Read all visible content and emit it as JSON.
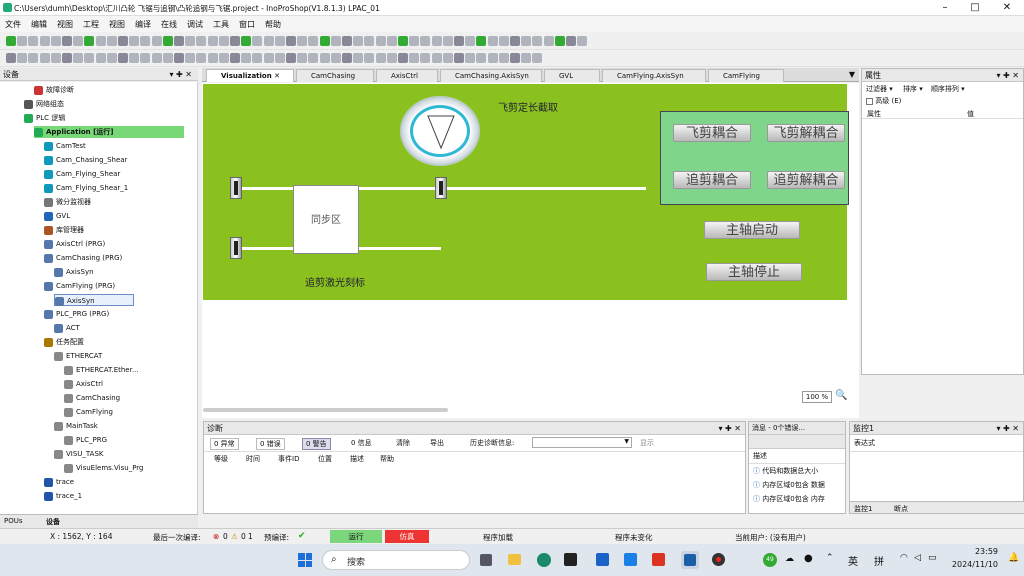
{
  "window": {
    "title": "C:\\Users\\dumh\\Desktop\\汇川凸轮 飞锯与追钢\\凸轮追钢与飞锯.project - InoProShop(V1.8.1.3) LPAC_01",
    "minimize": "–",
    "maximize": "□",
    "close": "✕"
  },
  "menu": [
    "文件",
    "编辑",
    "视图",
    "工程",
    "视图",
    "编译",
    "在线",
    "调试",
    "工具",
    "窗口",
    "帮助"
  ],
  "device_panel": {
    "title": "设备",
    "pin": "▾ ✚ ✕"
  },
  "tree": [
    {
      "label": "故障诊断",
      "indent": 3,
      "color": "#c33"
    },
    {
      "label": "网络组态",
      "indent": 2,
      "color": "#555"
    },
    {
      "label": "PLC 逻辑",
      "indent": 2,
      "color": "#2a5"
    },
    {
      "label": "Application [运行]",
      "indent": 3,
      "color": "#2a5",
      "highlight": true
    },
    {
      "label": "CamTest",
      "indent": 4,
      "color": "#19b"
    },
    {
      "label": "Cam_Chasing_Shear",
      "indent": 4,
      "color": "#19b"
    },
    {
      "label": "Cam_Flying_Shear",
      "indent": 4,
      "color": "#19b"
    },
    {
      "label": "Cam_Flying_Shear_1",
      "indent": 4,
      "color": "#19b"
    },
    {
      "label": "微分监视器",
      "indent": 4,
      "color": "#777"
    },
    {
      "label": "GVL",
      "indent": 4,
      "color": "#26b"
    },
    {
      "label": "库管理器",
      "indent": 4,
      "color": "#a52"
    },
    {
      "label": "AxisCtrl (PRG)",
      "indent": 4,
      "color": "#57a"
    },
    {
      "label": "CamChasing (PRG)",
      "indent": 4,
      "color": "#57a"
    },
    {
      "label": "AxisSyn",
      "indent": 5,
      "color": "#57a"
    },
    {
      "label": "CamFlying (PRG)",
      "indent": 4,
      "color": "#57a"
    },
    {
      "label": "AxisSyn",
      "indent": 5,
      "color": "#57a",
      "selected": true
    },
    {
      "label": "PLC_PRG (PRG)",
      "indent": 4,
      "color": "#57a"
    },
    {
      "label": "ACT",
      "indent": 5,
      "color": "#57a"
    },
    {
      "label": "任务配置",
      "indent": 4,
      "color": "#a70"
    },
    {
      "label": "ETHERCAT",
      "indent": 5,
      "color": "#888"
    },
    {
      "label": "ETHERCAT.Ether...",
      "indent": 6,
      "color": "#888"
    },
    {
      "label": "AxisCtrl",
      "indent": 6,
      "color": "#888"
    },
    {
      "label": "CamChasing",
      "indent": 6,
      "color": "#888"
    },
    {
      "label": "CamFlying",
      "indent": 6,
      "color": "#888"
    },
    {
      "label": "MainTask",
      "indent": 5,
      "color": "#888"
    },
    {
      "label": "PLC_PRG",
      "indent": 6,
      "color": "#888"
    },
    {
      "label": "VISU_TASK",
      "indent": 5,
      "color": "#888"
    },
    {
      "label": "VisuElems.Visu_Prg",
      "indent": 6,
      "color": "#888"
    },
    {
      "label": "trace",
      "indent": 4,
      "color": "#25a"
    },
    {
      "label": "trace_1",
      "indent": 4,
      "color": "#25a"
    }
  ],
  "bottom_tabs": [
    "POUs",
    "设备"
  ],
  "editor_tabs": [
    "Visualization",
    "CamChasing",
    "AxisCtrl",
    "CamChasing.AxisSyn",
    "GVL",
    "CamFlying.AxisSyn",
    "CamFlying"
  ],
  "hmi": {
    "title_fly": "飞剪定长截取",
    "title_chase": "追剪激光刻标",
    "sync_zone": "同步区",
    "btn_fly_couple": "飞剪耦合",
    "btn_fly_decouple": "飞剪解耦合",
    "btn_chase_couple": "追剪耦合",
    "btn_chase_decouple": "追剪解耦合",
    "btn_master_start": "主轴启动",
    "btn_master_stop": "主轴停止",
    "zoom": "100 %"
  },
  "props_panel": {
    "title": "属性",
    "filter": "过滤器",
    "sort": "排序",
    "order": "顺序排列",
    "advanced": "高级 (E)",
    "col_prop": "属性",
    "col_val": "值"
  },
  "diag_panel": {
    "title": "诊断",
    "btn_error": "0 异常",
    "btn_err2": "0 错误",
    "btn_warn": "0 警告",
    "btn_info": "0 信息",
    "clear": "清除",
    "export": "导出",
    "history": "历史诊断信息:",
    "show": "显示",
    "cols": [
      "等级",
      "时间",
      "事件ID",
      "位置",
      "描述",
      "帮助"
    ]
  },
  "msg_panel": {
    "title": "消息 - 0个错误...",
    "desc": "描述",
    "lines": [
      "代码和数据总大小",
      "内存区域0包含 数据",
      "内存区域0包含 内存"
    ]
  },
  "watch_panel": {
    "title": "监控1",
    "expr": "表达式",
    "tab1": "监控1",
    "tab2": "断点"
  },
  "status": {
    "coords": "X : 1562, Y : 164",
    "last_compile": "最后一次编译:",
    "c0": "0",
    "c1": "0",
    "c2": "1",
    "precompile": "预编译:",
    "run": "运行",
    "sim": "仿真",
    "prog_loaded": "程序加载",
    "prog_unchanged": "程序未变化",
    "user": "当前用户: (没有用户)"
  },
  "taskbar": {
    "search": "搜索",
    "lang": "英",
    "ime": "拼",
    "time": "23:59",
    "date": "2024/11/10",
    "badge": "49"
  }
}
